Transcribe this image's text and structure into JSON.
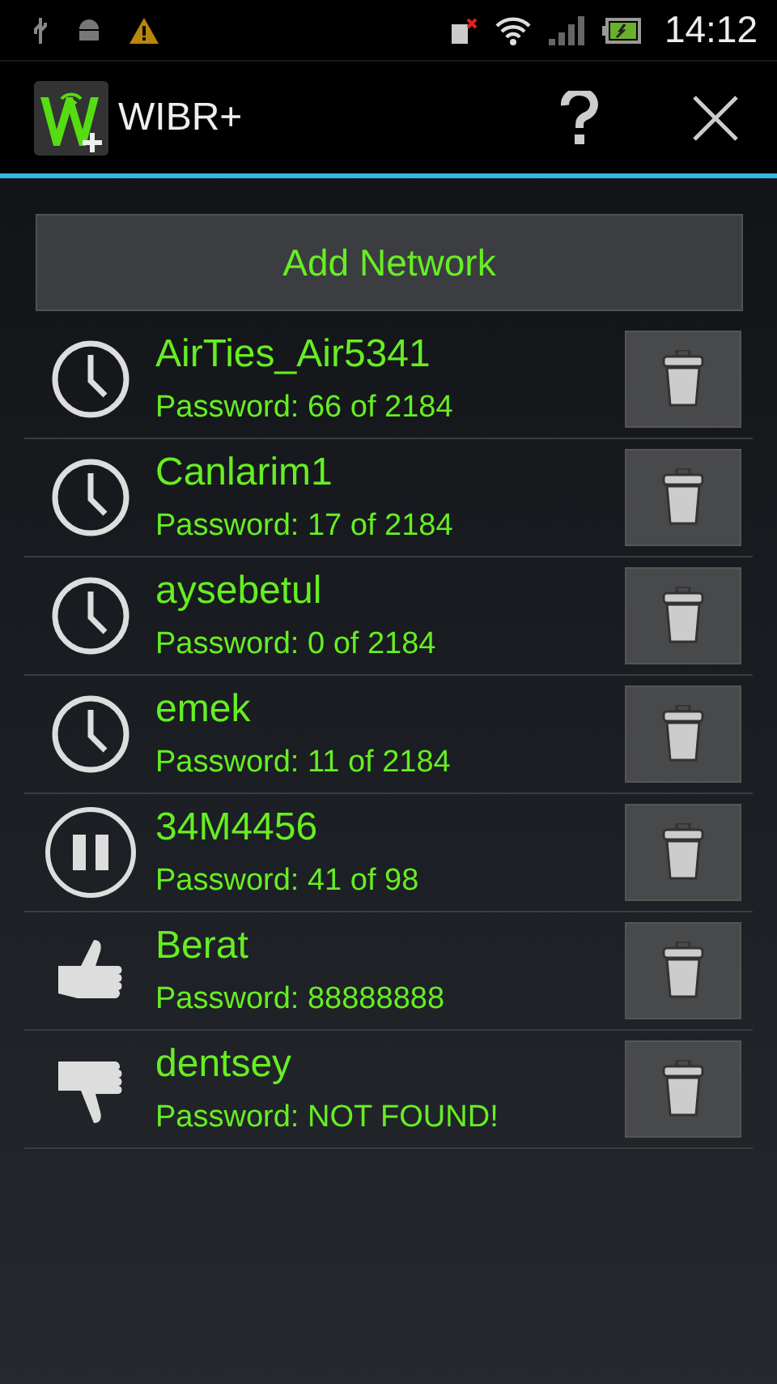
{
  "status_bar": {
    "time": "14:12"
  },
  "app_bar": {
    "title": "WIBR+"
  },
  "add_button": {
    "label": "Add Network"
  },
  "networks": [
    {
      "name": "AirTies_Air5341",
      "password": "Password: 66 of 2184",
      "kind": "waiting"
    },
    {
      "name": "Canlarim1",
      "password": "Password: 17 of 2184",
      "kind": "waiting"
    },
    {
      "name": "aysebetul",
      "password": "Password: 0 of 2184",
      "kind": "waiting"
    },
    {
      "name": "emek",
      "password": "Password: 11 of 2184",
      "kind": "waiting"
    },
    {
      "name": "34M4456",
      "password": "Password: 41 of 98",
      "kind": "paused"
    },
    {
      "name": "Berat",
      "password": "Password: 88888888",
      "kind": "found"
    },
    {
      "name": "dentsey",
      "password": "Password: NOT FOUND!",
      "kind": "notfound"
    }
  ]
}
